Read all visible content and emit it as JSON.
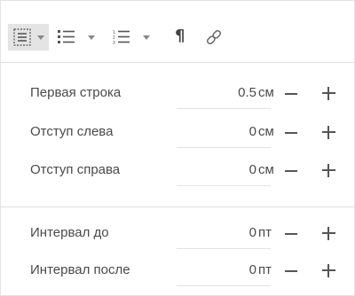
{
  "toolbar": {
    "buttons": [
      {
        "icon": "paragraph-indent-icon",
        "active": true,
        "has_dropdown": true
      },
      {
        "icon": "bulleted-list-icon",
        "active": false,
        "has_dropdown": true
      },
      {
        "icon": "numbered-list-icon",
        "active": false,
        "has_dropdown": true
      },
      {
        "icon": "pilcrow-icon",
        "glyph": "¶",
        "active": false,
        "has_dropdown": false
      },
      {
        "icon": "link-icon",
        "active": false,
        "has_dropdown": false
      }
    ]
  },
  "indent": {
    "first_line": {
      "label": "Первая строка",
      "value": "0.5",
      "unit": "см"
    },
    "left": {
      "label": "Отступ слева",
      "value": "0",
      "unit": "см"
    },
    "right": {
      "label": "Отступ справа",
      "value": "0",
      "unit": "см"
    }
  },
  "spacing": {
    "before": {
      "label": "Интервал до",
      "value": "0",
      "unit": "пт"
    },
    "after": {
      "label": "Интервал после",
      "value": "0",
      "unit": "пт"
    }
  },
  "colors": {
    "accent_bg": "#e4e4e4",
    "text": "#4a4a4a",
    "icon": "#555555"
  }
}
